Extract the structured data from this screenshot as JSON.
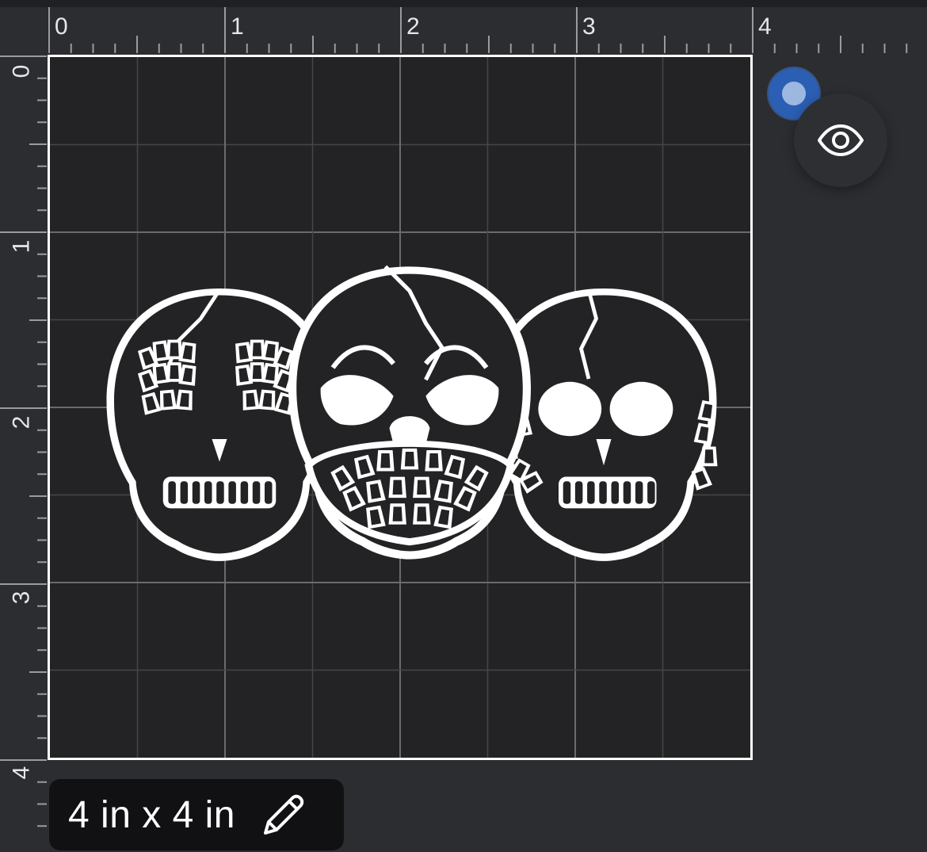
{
  "canvas": {
    "size_label": "4 in x 4 in",
    "units": "in"
  },
  "rulers": {
    "top_labels": [
      "0",
      "1",
      "2",
      "3",
      "4"
    ],
    "left_labels": [
      "0",
      "1",
      "2",
      "3",
      "4"
    ]
  },
  "icons": {
    "visibility": "eye-icon",
    "edit": "pencil-icon",
    "handle": "selection-handle"
  },
  "colors": {
    "background": "#2c2d31",
    "mat": "#232325",
    "accent": "#2b5fb3",
    "chip": "#111113"
  }
}
